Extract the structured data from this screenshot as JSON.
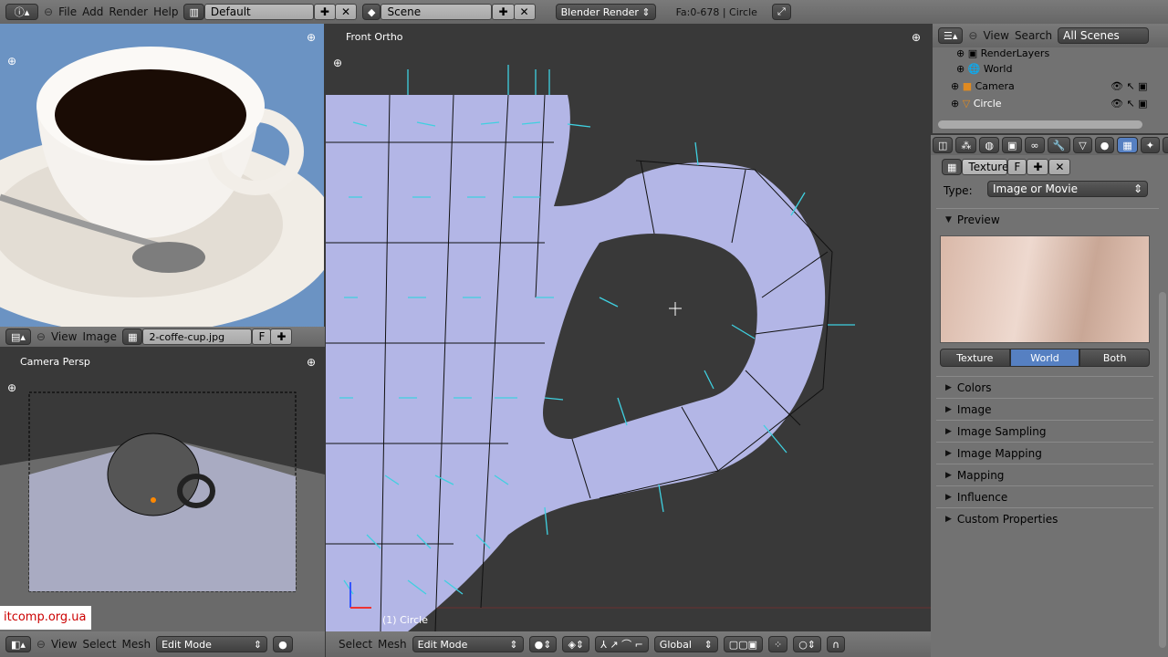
{
  "topbar": {
    "menus": [
      "File",
      "Add",
      "Render",
      "Help"
    ],
    "layout": "Default",
    "scene": "Scene",
    "engine": "Blender Render",
    "stats": "Fa:0-678 | Circle"
  },
  "image_editor": {
    "menus": [
      "View",
      "Image"
    ],
    "image_name": "2-coffe-cup.jpg",
    "fake_user": "F"
  },
  "camera_view": {
    "label": "Camera Persp",
    "menus": [
      "View",
      "Select",
      "Mesh"
    ],
    "mode": "Edit Mode"
  },
  "main_view": {
    "label": "Front Ortho",
    "object_label": "(1) Circle",
    "menus": [
      "Select",
      "Mesh"
    ],
    "mode": "Edit Mode",
    "orientation": "Global"
  },
  "outliner": {
    "menus": [
      "View",
      "Search"
    ],
    "filter": "All Scenes",
    "items": [
      "RenderLayers",
      "World",
      "Camera",
      "Circle"
    ]
  },
  "properties": {
    "datablock": "Texture",
    "fake_user": "F",
    "type_label": "Type:",
    "type_value": "Image or Movie",
    "preview_label": "Preview",
    "preview_tabs": [
      "Texture",
      "World",
      "Both"
    ],
    "active_tab": "World",
    "panels": [
      "Colors",
      "Image",
      "Image Sampling",
      "Image Mapping",
      "Mapping",
      "Influence",
      "Custom Properties"
    ]
  },
  "watermark": "itcomp.org.ua",
  "colors": {
    "accent": "#5680c2",
    "viewport": "#393939",
    "mesh": "#b8bce8",
    "normals": "#3fd0e0"
  }
}
